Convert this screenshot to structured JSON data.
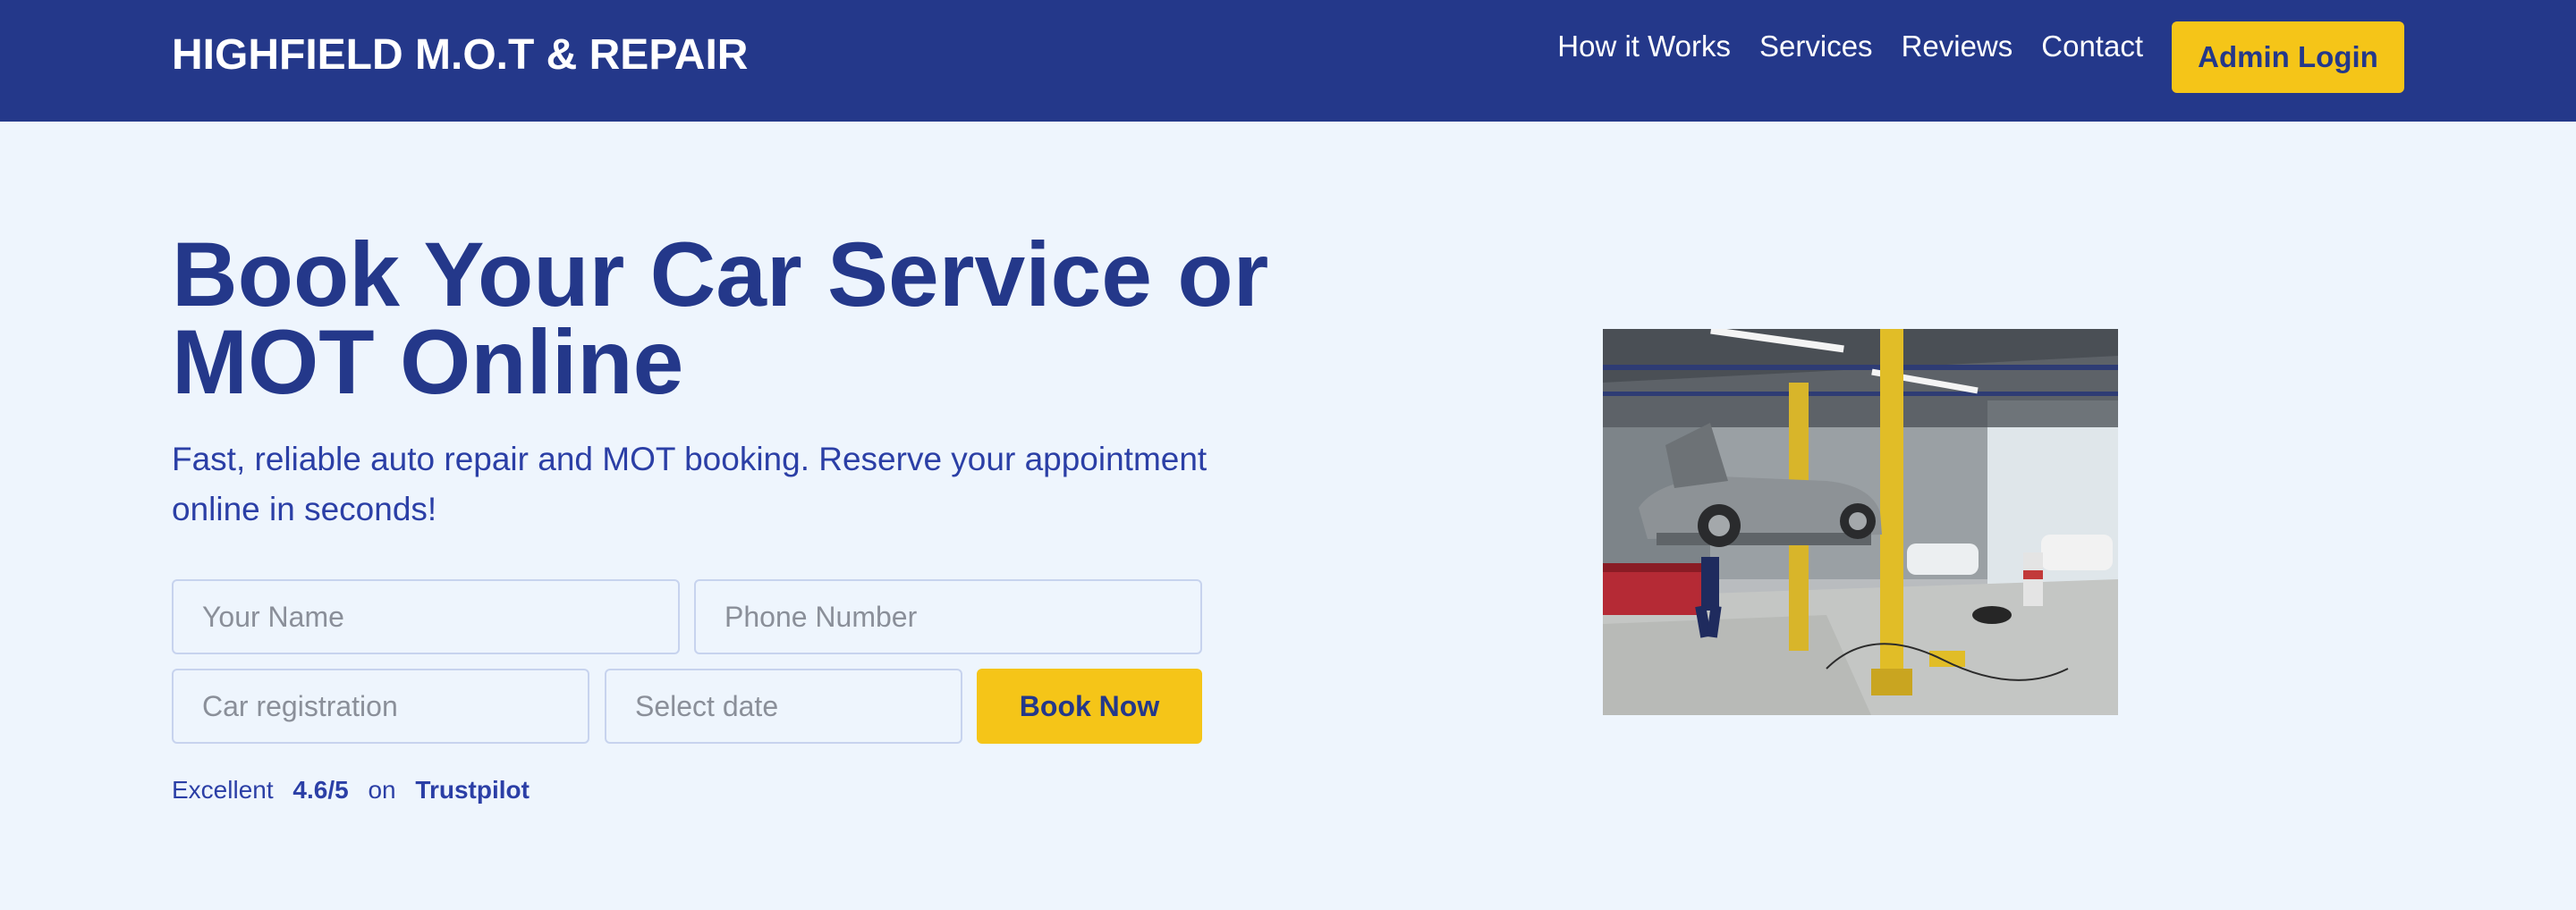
{
  "header": {
    "brand": "HIGHFIELD M.O.T & REPAIR",
    "nav": [
      "How it Works",
      "Services",
      "Reviews",
      "Contact"
    ],
    "admin_label": "Admin Login"
  },
  "hero": {
    "title": "Book Your Car Service or MOT Online",
    "subtitle": "Fast, reliable auto repair and MOT booking. Reserve your appointment online in seconds!",
    "form": {
      "name_placeholder": "Your Name",
      "phone_placeholder": "Phone Number",
      "reg_placeholder": "Car registration",
      "date_placeholder": "Select date",
      "submit_label": "Book Now"
    },
    "trust": {
      "rating_text": "Excellent",
      "score": "4.6/5",
      "on": "on",
      "platform": "Trustpilot"
    }
  },
  "image": {
    "alt": "Garage workshop with a car raised on a yellow two-post lift"
  },
  "colors": {
    "header_bg": "#24388a",
    "page_bg": "#eef5fd",
    "accent": "#f5c518",
    "heading": "#24388a",
    "text": "#2b3fa6"
  }
}
